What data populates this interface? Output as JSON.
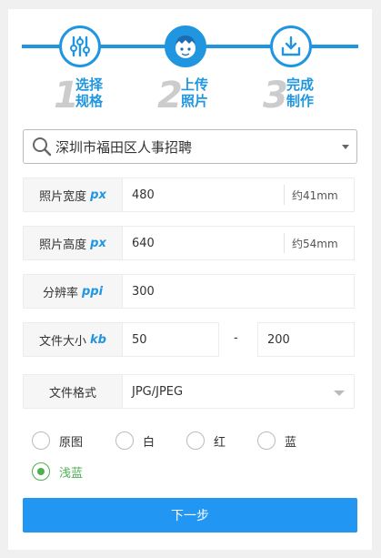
{
  "steps": [
    {
      "num": "1",
      "line1": "选择",
      "line2": "规格",
      "icon": "sliders-icon"
    },
    {
      "num": "2",
      "line1": "上传",
      "line2": "照片",
      "icon": "person-avatar-icon"
    },
    {
      "num": "3",
      "line1": "完成",
      "line2": "制作",
      "icon": "download-icon"
    }
  ],
  "spec_select": {
    "value": "深圳市福田区人事招聘"
  },
  "fields": {
    "width": {
      "label": "照片宽度",
      "unit": "px",
      "value": "480",
      "suffix": "约41mm"
    },
    "height": {
      "label": "照片高度",
      "unit": "px",
      "value": "640",
      "suffix": "约54mm"
    },
    "dpi": {
      "label": "分辨率",
      "unit": "ppi",
      "value": "300"
    },
    "filesize": {
      "label": "文件大小",
      "unit": "kb",
      "min": "50",
      "dash": "-",
      "max": "200"
    },
    "format": {
      "label": "文件格式",
      "value": "JPG/JPEG"
    }
  },
  "background_options": [
    {
      "label": "原图",
      "checked": false
    },
    {
      "label": "白",
      "checked": false
    },
    {
      "label": "红",
      "checked": false
    },
    {
      "label": "蓝",
      "checked": false
    },
    {
      "label": "浅蓝",
      "checked": true
    }
  ],
  "next_button": {
    "label": "下一步"
  },
  "colors": {
    "accent": "#2196e0",
    "checked": "#4caf50",
    "button": "#2196f3"
  }
}
